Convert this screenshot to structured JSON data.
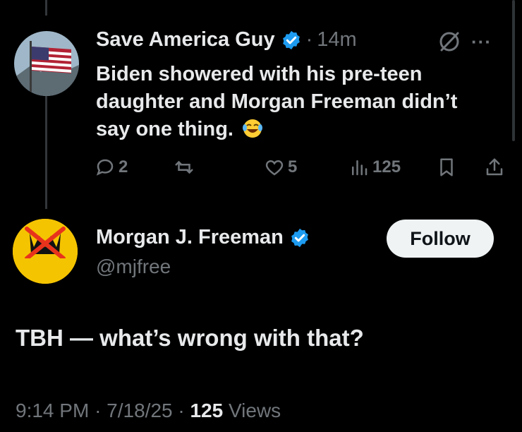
{
  "tweet1": {
    "author_name": "Save America Guy",
    "separator": "·",
    "time_ago": "14m",
    "text": "Biden showered with his pre-teen daughter and Morgan Freeman didn’t say one thing.",
    "emoji": "face-with-tears-of-joy",
    "actions": {
      "replies": "2",
      "retweets": "",
      "likes": "5",
      "views": "125"
    }
  },
  "tweet2": {
    "author_name": "Morgan J. Freeman",
    "handle": "@mjfree",
    "follow_label": "Follow",
    "text": "TBH — what’s wrong with that?",
    "meta_time": "9:14 PM",
    "meta_sep1": "·",
    "meta_date": "7/18/25",
    "meta_sep2": "·",
    "meta_views": "125",
    "meta_views_label": "Views"
  },
  "colors": {
    "background": "#000000",
    "primary_text": "#e7e9ea",
    "secondary_text": "#71767b",
    "verified_blue": "#1d9bf0",
    "follow_bg": "#eff3f4"
  }
}
